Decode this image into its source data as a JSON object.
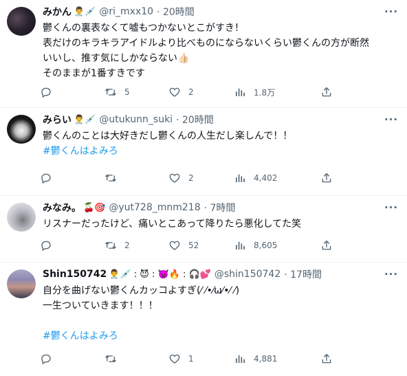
{
  "tweets": [
    {
      "name": "みかん",
      "name_emoji": "👨‍⚕️💉",
      "handle": "@ri_mxx10",
      "time": "· 20時間",
      "lines": [
        "鬱くんの裏表なくて嘘もつかないとこがすき！",
        "表だけのキラキラアイドルより比べものにならないくらい鬱くんの方が断然",
        "いいし、推す気にしかならない👍🏻",
        "そのままが1番すきです"
      ],
      "hashtag": "",
      "replies": "",
      "retweets": "5",
      "likes": "2",
      "views": "1.8万"
    },
    {
      "name": "みらい",
      "name_emoji": "👨‍⚕️💉",
      "handle": "@utukunn_suki",
      "time": "· 20時間",
      "lines": [
        "鬱くんのことは大好きだし鬱くんの人生だし楽しんで！！"
      ],
      "hashtag": "#鬱くんはよみろ",
      "replies": "",
      "retweets": "",
      "likes": "2",
      "views": "4,402"
    },
    {
      "name": "みなみ。",
      "name_emoji": "🍒🎯",
      "handle": "@yut728_mnm218",
      "time": "· 7時間",
      "lines": [
        "リスナーだったけど、痛いとこあって降りたら悪化してた笑"
      ],
      "hashtag": "",
      "replies": "",
      "retweets": "2",
      "likes": "52",
      "views": "8,605"
    },
    {
      "name": "Shin150742",
      "name_emoji": "👨‍⚕️💉 : 😈 : 👿🔥 : 🎧💕",
      "handle": "@shin150742",
      "time": "· 17時間",
      "lines": [
        "自分を曲げない鬱くんカッコよすぎ(⁄ ⁄•⁄ω⁄•⁄ ⁄)",
        "一生ついていきます！！！"
      ],
      "hashtag": "#鬱くんはよみろ",
      "replies": "",
      "retweets": "",
      "likes": "1",
      "views": "4,881"
    }
  ],
  "icons": {
    "more": "more-icon",
    "reply": "reply-icon",
    "retweet": "retweet-icon",
    "like": "heart-icon",
    "views": "views-icon",
    "share": "share-icon"
  },
  "colors": {
    "text": "#0f1419",
    "secondary": "#536471",
    "link": "#1d9bf0",
    "divider": "#eff3f4"
  }
}
